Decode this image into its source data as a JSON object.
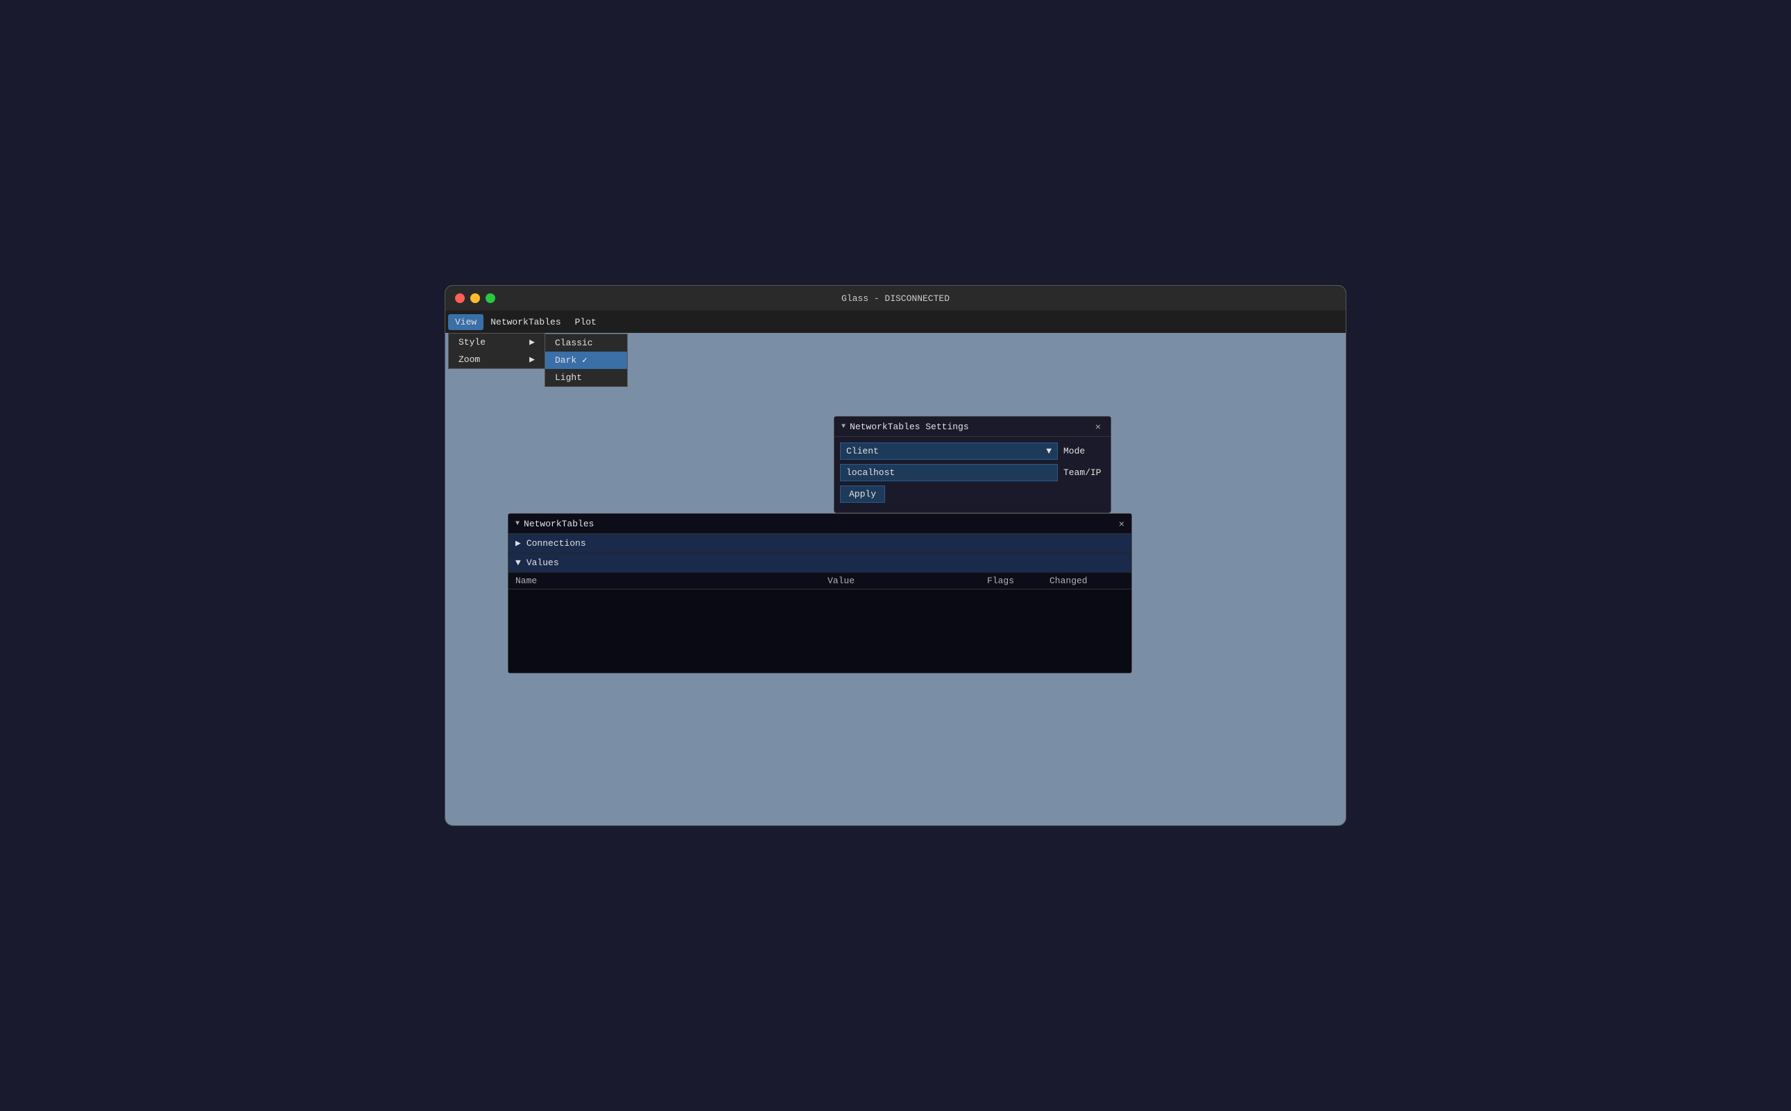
{
  "window": {
    "title": "Glass - DISCONNECTED"
  },
  "menubar": {
    "items": [
      {
        "id": "view",
        "label": "View",
        "active": true
      },
      {
        "id": "networktables",
        "label": "NetworkTables"
      },
      {
        "id": "plot",
        "label": "Plot"
      }
    ]
  },
  "view_dropdown": {
    "items": [
      {
        "id": "style",
        "label": "Style",
        "has_sub": true
      },
      {
        "id": "zoom",
        "label": "Zoom",
        "has_sub": true
      }
    ]
  },
  "style_submenu": {
    "items": [
      {
        "id": "classic",
        "label": "Classic",
        "checked": false
      },
      {
        "id": "dark",
        "label": "Dark",
        "checked": true
      },
      {
        "id": "light",
        "label": "Light",
        "checked": false
      }
    ]
  },
  "nt_settings": {
    "title": "NetworkTables Settings",
    "mode_label": "Mode",
    "mode_value": "Client",
    "team_ip_label": "Team/IP",
    "server_value": "localhost",
    "apply_label": "Apply",
    "close_label": "×"
  },
  "nt_panel": {
    "title": "NetworkTables",
    "close_label": "×",
    "sections": [
      {
        "id": "connections",
        "label": "Connections",
        "collapsed": true
      },
      {
        "id": "values",
        "label": "Values",
        "collapsed": false
      }
    ],
    "table": {
      "columns": [
        "Name",
        "Value",
        "Flags",
        "Changed"
      ]
    }
  },
  "icons": {
    "collapse_down": "▼",
    "collapse_right": "▶",
    "chevron_down": "▼",
    "checkmark": "✓",
    "sub_arrow": "▶"
  }
}
